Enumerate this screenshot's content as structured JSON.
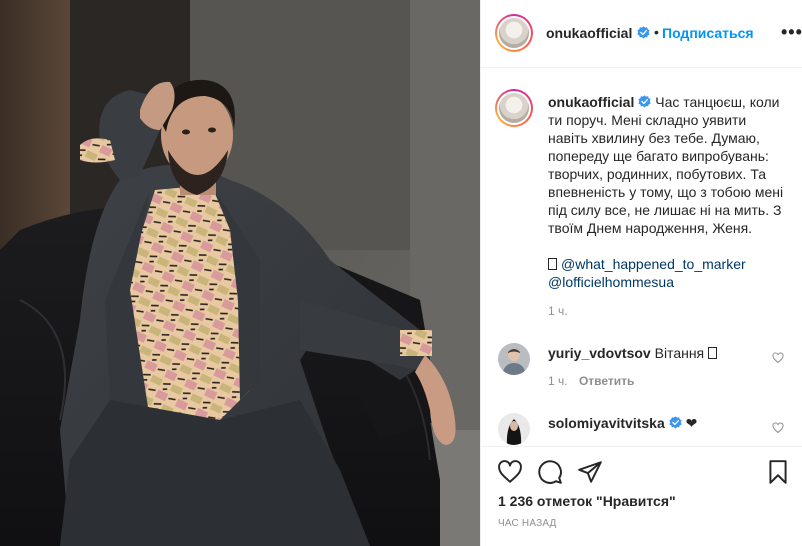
{
  "post": {
    "username": "onukaofficial",
    "follow_label": "Подписаться",
    "separator": "•",
    "more_label": "•••"
  },
  "caption": {
    "username": "onukaofficial",
    "text": "Час танцюєш, коли ти поруч. Мені складно уявити навіть хвилину без тебе. Думаю, попереду ще багато випробувань: творчих, родинних, побутових. Та впевненість у тому, що з тобою мені під силу все, не лишає ні на мить. З твоїм Днем народження, Женя.",
    "mention_1": "@what_happened_to_marker",
    "mention_2": "@lofficielhommesua",
    "time": "1 ч."
  },
  "comments": [
    {
      "username": "yuriy_vdovtsov",
      "text": "Вітання",
      "time": "1 ч.",
      "reply_label": "Ответить"
    },
    {
      "username": "solomiyavitvitska",
      "text": "❤"
    }
  ],
  "actions": {
    "likes": "1 236 отметок \"Нравится\"",
    "time_ago": "ЧАС НАЗАД"
  },
  "colors": {
    "accent": "#0095f6",
    "verified": "#3897f0",
    "mention": "#00376b",
    "muted": "#8e8e8e"
  }
}
